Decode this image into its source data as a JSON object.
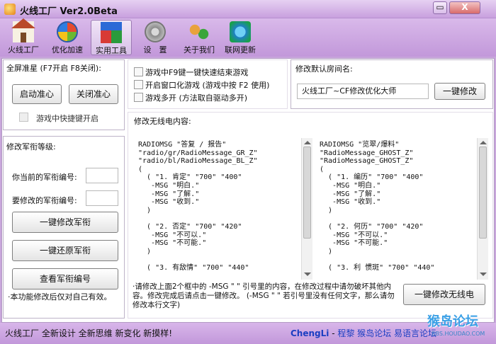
{
  "window": {
    "title": "火线工厂 Ver2.0Beta",
    "min_glyph": "▭",
    "close_glyph": "X"
  },
  "toolbar": {
    "items": [
      {
        "label": "火线工厂",
        "icon": "house-icon"
      },
      {
        "label": "优化加速",
        "icon": "windows-logo-icon"
      },
      {
        "label": "实用工具",
        "icon": "cubes-icon",
        "active": true
      },
      {
        "label": "设　置",
        "icon": "gear-icon"
      },
      {
        "label": "关于我们",
        "icon": "people-icon"
      },
      {
        "label": "联网更新",
        "icon": "globe-icon"
      }
    ]
  },
  "crosshair": {
    "title": "全屏准星 (F7开启  F8关闭):",
    "start_label": "启动准心",
    "close_label": "关闭准心",
    "hotkey_label": "游戏中快捷键开启"
  },
  "options": {
    "opt1": "游戏中F9键一键快速结束游戏",
    "opt2": "开启窗口化游戏 (游戏中按 F2 使用)",
    "opt3": "游戏多开 (方法取自驱动多开)"
  },
  "room": {
    "title": "修改默认房间名:",
    "value": "火线工厂~CF修改优化大师",
    "button": "一键修改"
  },
  "rank": {
    "title": "修改军衔等级:",
    "current_label": "你当前的军衔编号:",
    "target_label": "要修改的军衔编号:",
    "btn_modify": "一键修改军衔",
    "btn_restore": "一键还原军衔",
    "btn_view": "查看军衔编号",
    "note": "·本功能修改后仅对自己有效。"
  },
  "radio": {
    "title": "修改无线电内容:",
    "left_text": "RADIOMSG \"答复 / 报告\"\n\"radio/gr/RadioMessage_GR_Z\"\n\"radio/bl/RadioMessage_BL_Z\"\n(\n  ( \"1. 肯定\" \"700\" \"400\"\n   -MSG \"明白.\"\n   -MSG \"了解.\"\n   -MSG \"收到.\"\n  )\n\n  ( \"2. 否定\" \"700\" \"420\"\n   -MSG \"不可以.\"\n   -MSG \"不可能.\"\n  )\n\n  ( \"3. 有敌情\" \"700\" \"440\"",
    "right_text": "RADIOMSG \"览翠/爆料\"\n\"RadioMessage_GHOST_Z\"\n\"RadioMessage_GHOST_Z\"\n(\n  ( \"1. 编历\" \"700\" \"400\"\n   -MSG \"明白.\"\n   -MSG \"了解.\"\n   -MSG \"收到.\"\n  )\n\n  ( \"2. 何历\" \"700\" \"420\"\n   -MSG \"不可以.\"\n   -MSG \"不可能.\"\n  )\n\n  ( \"3. 利 惯斑\" \"700\" \"440\"",
    "instruction": "·请修改上面2个框中的 -MSG \" \" 引号里的内容，在修改过程中请勿破坏其他内容。修改完成后请点击一键修改。  (-MSG \" \" 若引号里没有任何文字，那么请勿修改本行文字)",
    "button": "一键修改无线电"
  },
  "status": {
    "left": "火线工厂 全新设计 全新思维 新变化 新摸样!",
    "right_name": "ChengLi",
    "right_sep": " - ",
    "right_rest": "程黎  猴岛论坛  易语言论坛"
  },
  "watermark": {
    "big": "猴岛论坛",
    "small": "BBS.HOUDAO.COM"
  }
}
